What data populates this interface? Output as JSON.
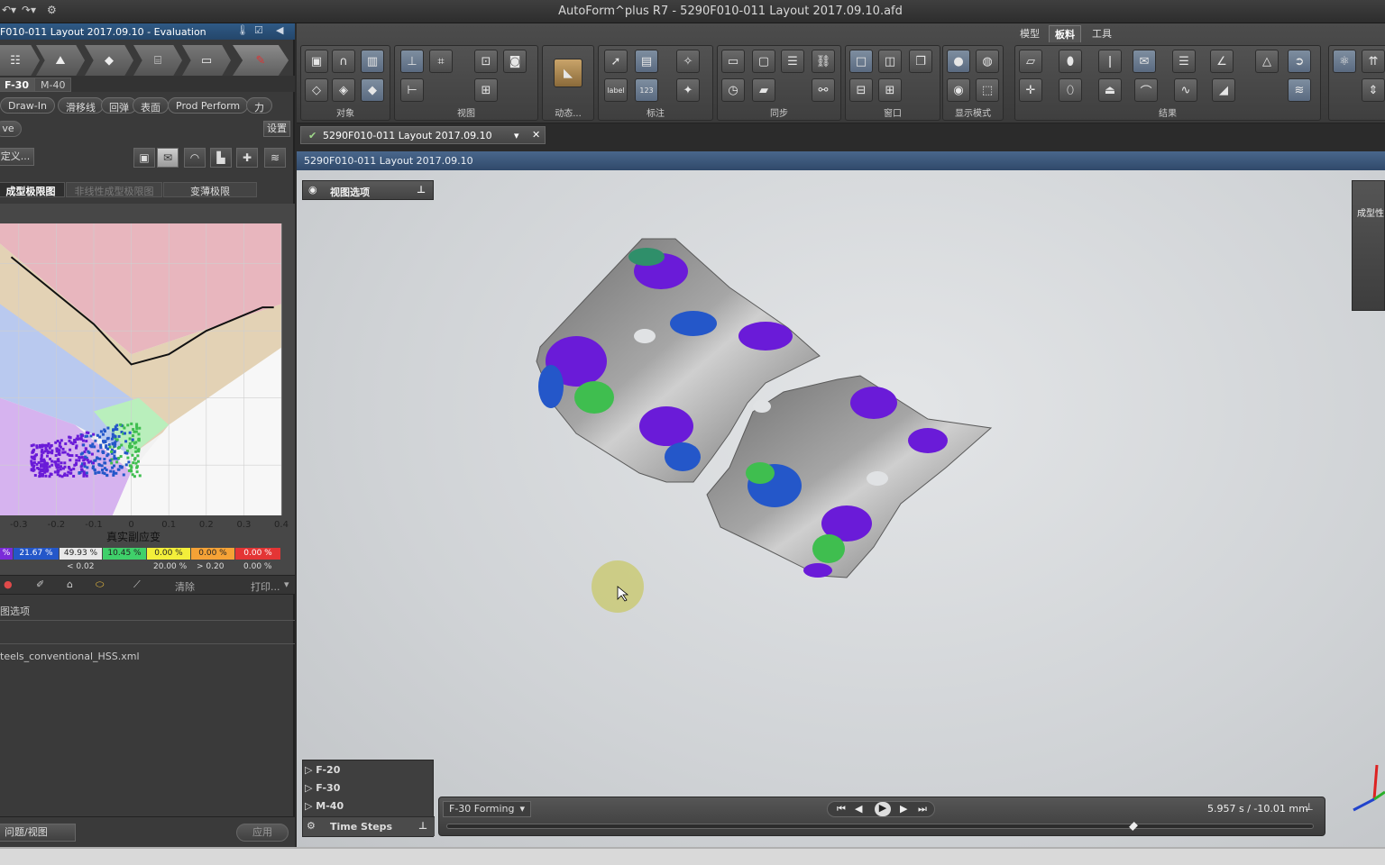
{
  "window": {
    "title": "AutoForm^plus R7 - 5290F010-011  Layout 2017.09.10.afd"
  },
  "left_panel": {
    "header_title": "F010-011 Layout 2017.09.10 - Evaluation",
    "process_steps": [
      "Setup",
      "Tool",
      "Blank",
      "Process",
      "Control",
      "Results"
    ],
    "op_tabs": [
      "F-30",
      "M-40"
    ],
    "result_pills": [
      "Draw-In",
      "滑移线",
      "回弹",
      "表面",
      "Prod Perform",
      "力"
    ],
    "settings_label": "设置",
    "ve_label": "ve",
    "define_label": "定义...",
    "subtabs": [
      "成型极限图",
      "非线性成型极限图",
      "变薄极限"
    ],
    "x_ticks": [
      "-0.3",
      "-0.2",
      "-0.1",
      "0",
      "0.1",
      "0.2",
      "0.3",
      "0.4"
    ],
    "x_axis_label": "真实副应变",
    "legend_values": [
      "%",
      "21.67 %",
      "49.93 %",
      "10.45 %",
      "0.00 %",
      "0.00 %",
      "0.00 %"
    ],
    "thresholds": [
      "< 0.02",
      "20.00 %",
      "> 0.20",
      "0.00 %"
    ],
    "clear_label": "清除",
    "print_label": "打印...",
    "options_label": "图选项",
    "material_file": "teels_conventional_HSS.xml",
    "bottom_left_label": "问题/视图",
    "apply_label": "应用"
  },
  "ribbon": {
    "top_tabs": [
      "模型",
      "板料",
      "工具"
    ],
    "active_tab": "板料",
    "groups": [
      "对象",
      "视图",
      "动态...",
      "标注",
      "同步",
      "窗口",
      "显示模式",
      "结果"
    ],
    "label_icon_text": "label",
    "num_icon_text": "123"
  },
  "doc_tab": {
    "title": "5290F010-011  Layout 2017.09.10"
  },
  "doc_bar": {
    "title": "5290F010-011  Layout 2017.09.10"
  },
  "view_options": {
    "label": "视图选项"
  },
  "right_cutoff": {
    "label": "成型性"
  },
  "steps_panel": {
    "items": [
      "F-20",
      "F-30",
      "M-40"
    ],
    "footer": "Time Steps"
  },
  "timeline": {
    "op_select": "F-30 Forming",
    "time_readout": "5.957 s / -10.01 mm",
    "progress": 0.79
  },
  "colors": {
    "purple": "#6a1bd8",
    "blue": "#2457c9",
    "green": "#3fbe4f",
    "gray": "#7d7d7d",
    "accent": "#2f5a86"
  },
  "chart_data": {
    "type": "scatter",
    "title": "",
    "xlabel": "真实副应变",
    "ylabel": "",
    "xlim": [
      -0.35,
      0.4
    ],
    "x_ticks": [
      -0.3,
      -0.2,
      -0.1,
      0,
      0.1,
      0.2,
      0.3,
      0.4
    ],
    "flc_curve": {
      "x": [
        -0.32,
        -0.1,
        0.0,
        0.1,
        0.2,
        0.35,
        0.38
      ],
      "y": [
        0.62,
        0.42,
        0.3,
        0.33,
        0.4,
        0.47,
        0.47
      ]
    },
    "zones": [
      "purple",
      "blue",
      "green",
      "yellow",
      "orange",
      "red"
    ],
    "point_cloud": {
      "x_range": [
        -0.27,
        0.02
      ],
      "y_range": [
        -0.03,
        0.14
      ]
    }
  }
}
